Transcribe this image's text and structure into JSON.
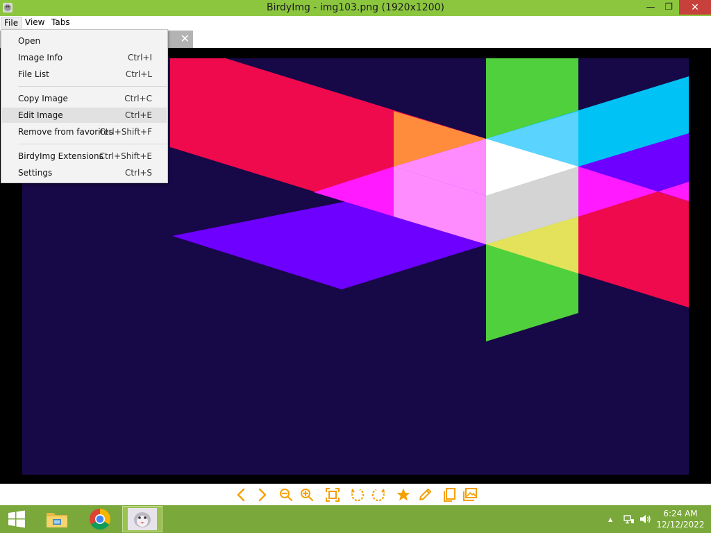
{
  "window": {
    "title": "BirdyImg - img103.png (1920x1200)",
    "min_glyph": "—",
    "max_glyph": "❐",
    "close_glyph": "✕",
    "icon": "birdyimg-app-icon"
  },
  "menubar": {
    "file": "File",
    "view": "View",
    "tabs": "Tabs"
  },
  "tab": {
    "close_glyph": "✕"
  },
  "file_menu": {
    "items": [
      {
        "label": "Open",
        "shortcut": ""
      },
      {
        "label": "Image Info",
        "shortcut": "Ctrl+I"
      },
      {
        "label": "File List",
        "shortcut": "Ctrl+L"
      },
      {
        "label": "Copy Image",
        "shortcut": "Ctrl+C"
      },
      {
        "label": "Edit Image",
        "shortcut": "Ctrl+E"
      },
      {
        "label": "Remove from favorites",
        "shortcut": "Ctrl+Shift+F"
      },
      {
        "label": "BirdyImg Extensions",
        "shortcut": "Ctrl+Shift+E"
      },
      {
        "label": "Settings",
        "shortcut": "Ctrl+S"
      }
    ],
    "highlighted": "Edit Image"
  },
  "image": {
    "background_color": "#170847",
    "colors": {
      "red": "#ee0a4d",
      "orange": "#ff8c3c",
      "green": "#50d03c",
      "cyan": "#00c2f5",
      "purple": "#6e00ff",
      "magenta": "#ff1aff",
      "pink": "#ff8cff",
      "light_blue": "#5bd3ff",
      "white": "#ffffff",
      "light_gray": "#d4d4d4",
      "yellow": "#e4e25a"
    }
  },
  "toolbar": {
    "accent_color": "#f5a000",
    "icons": [
      "chevron-left-icon",
      "chevron-right-icon",
      "zoom-out-icon",
      "zoom-in-icon",
      "fit-screen-icon",
      "rotate-left-icon",
      "rotate-right-icon",
      "star-icon",
      "edit-pencil-icon",
      "copy-icon",
      "gallery-icon"
    ]
  },
  "taskbar": {
    "color": "#7aa83a",
    "items": [
      "start-windows-icon",
      "file-explorer-icon",
      "chrome-icon",
      "birdyimg-taskbar-icon"
    ],
    "tray_up_glyph": "▲",
    "time": "6:24 AM",
    "date": "12/12/2022"
  }
}
